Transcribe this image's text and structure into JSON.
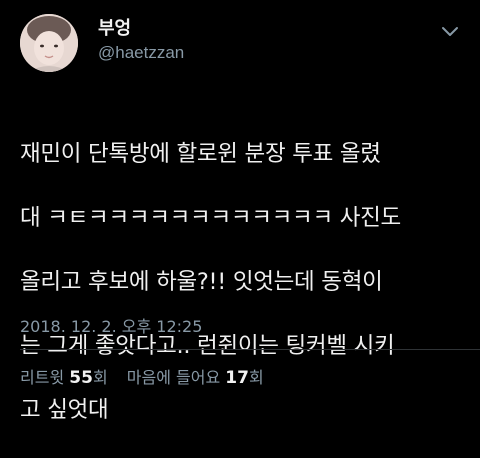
{
  "user": {
    "display_name": "부엉",
    "handle": "@haetzzan"
  },
  "tweet": {
    "text_lines": [
      "재민이 단톡방에 할로윈 분장 투표 올렸",
      "대 ㅋㅌㅋㅋㅋㅋㅋㅋㅋㅋㅋㅋㅋㅋ 사진도",
      "올리고 후보에 하울?!! 잇엇는데 동혁이",
      "는 그게 좋앗다고.. 런쥔이는 팅커벨 시키",
      "고 싶엇대"
    ],
    "timestamp": "2018. 12. 2. 오후 12:25"
  },
  "stats": {
    "retweets_label": "리트윗",
    "retweets_count": "55",
    "retweets_unit": "회",
    "likes_label": "마음에 들어요",
    "likes_count": "17",
    "likes_unit": "회"
  },
  "icons": {
    "more": "chevron-down-icon"
  },
  "colors": {
    "background": "#000000",
    "text": "#f0f0f0",
    "secondary": "#8899a6",
    "divider": "#2f3336"
  }
}
